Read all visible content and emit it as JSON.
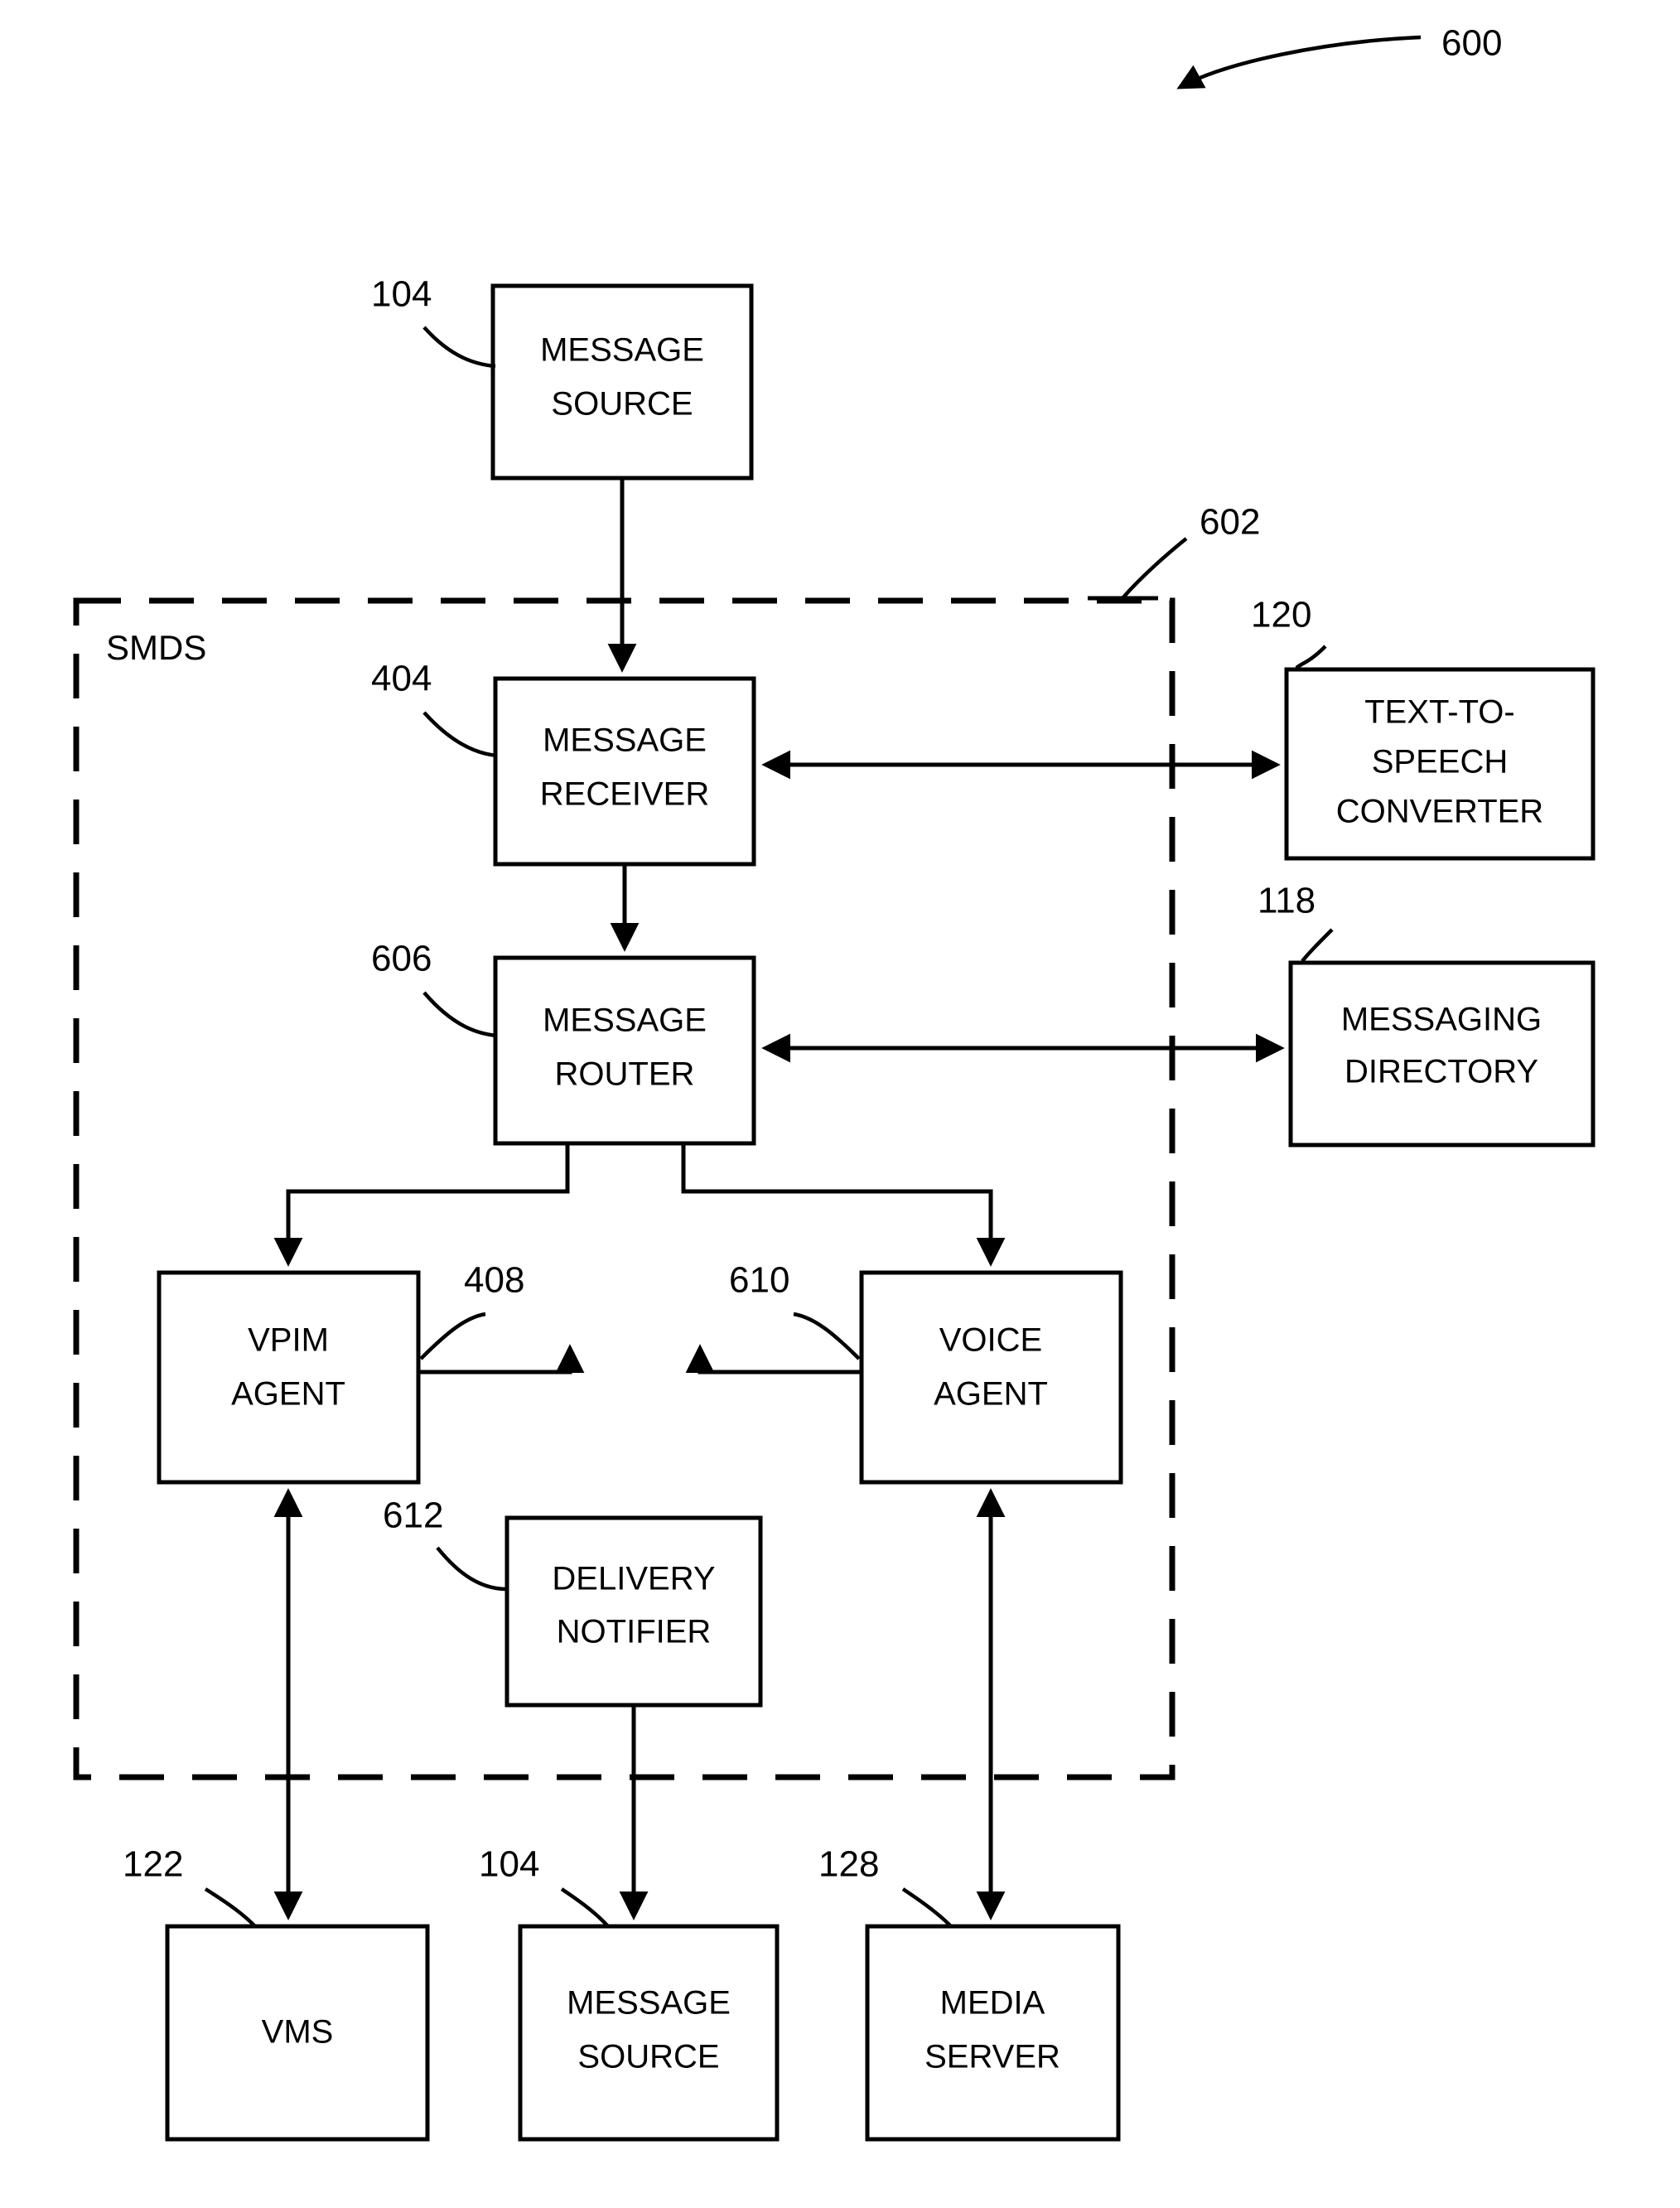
{
  "figure": {
    "reference_numeral": "600",
    "group": {
      "label": "SMDS",
      "reference_numeral": "602"
    }
  },
  "boxes": [
    {
      "id": "message-source-top",
      "lines": [
        "MESSAGE",
        "SOURCE"
      ],
      "ref": "104"
    },
    {
      "id": "message-receiver",
      "lines": [
        "MESSAGE",
        "RECEIVER"
      ],
      "ref": "404"
    },
    {
      "id": "text-to-speech-converter",
      "lines": [
        "TEXT-TO-",
        "SPEECH",
        "CONVERTER"
      ],
      "ref": "120"
    },
    {
      "id": "message-router",
      "lines": [
        "MESSAGE",
        "ROUTER"
      ],
      "ref": "606"
    },
    {
      "id": "messaging-directory",
      "lines": [
        "MESSAGING",
        "DIRECTORY"
      ],
      "ref": "118"
    },
    {
      "id": "vpim-agent",
      "lines": [
        "VPIM",
        "AGENT"
      ],
      "ref": "408"
    },
    {
      "id": "voice-agent",
      "lines": [
        "VOICE",
        "AGENT"
      ],
      "ref": "610"
    },
    {
      "id": "delivery-notifier",
      "lines": [
        "DELIVERY",
        "NOTIFIER"
      ],
      "ref": "612"
    },
    {
      "id": "vms",
      "lines": [
        "VMS"
      ],
      "ref": "122"
    },
    {
      "id": "message-source-bottom",
      "lines": [
        "MESSAGE",
        "SOURCE"
      ],
      "ref": "104"
    },
    {
      "id": "media-server",
      "lines": [
        "MEDIA",
        "SERVER"
      ],
      "ref": "128"
    }
  ],
  "text": {
    "fig_ref": "600",
    "smds_label": "SMDS",
    "smds_ref": "602",
    "message_source_top_l1": "MESSAGE",
    "message_source_top_l2": "SOURCE",
    "message_source_top_ref": "104",
    "message_receiver_l1": "MESSAGE",
    "message_receiver_l2": "RECEIVER",
    "message_receiver_ref": "404",
    "tts_l1": "TEXT-TO-",
    "tts_l2": "SPEECH",
    "tts_l3": "CONVERTER",
    "tts_ref": "120",
    "message_router_l1": "MESSAGE",
    "message_router_l2": "ROUTER",
    "message_router_ref": "606",
    "messaging_directory_l1": "MESSAGING",
    "messaging_directory_l2": "DIRECTORY",
    "messaging_directory_ref": "118",
    "vpim_agent_l1": "VPIM",
    "vpim_agent_l2": "AGENT",
    "vpim_agent_ref": "408",
    "voice_agent_l1": "VOICE",
    "voice_agent_l2": "AGENT",
    "voice_agent_ref": "610",
    "delivery_notifier_l1": "DELIVERY",
    "delivery_notifier_l2": "NOTIFIER",
    "delivery_notifier_ref": "612",
    "vms_l1": "VMS",
    "vms_ref": "122",
    "message_source_bottom_l1": "MESSAGE",
    "message_source_bottom_l2": "SOURCE",
    "message_source_bottom_ref": "104",
    "media_server_l1": "MEDIA",
    "media_server_l2": "SERVER",
    "media_server_ref": "128"
  },
  "colors": {
    "ink": "#000000",
    "paper": "#ffffff"
  }
}
